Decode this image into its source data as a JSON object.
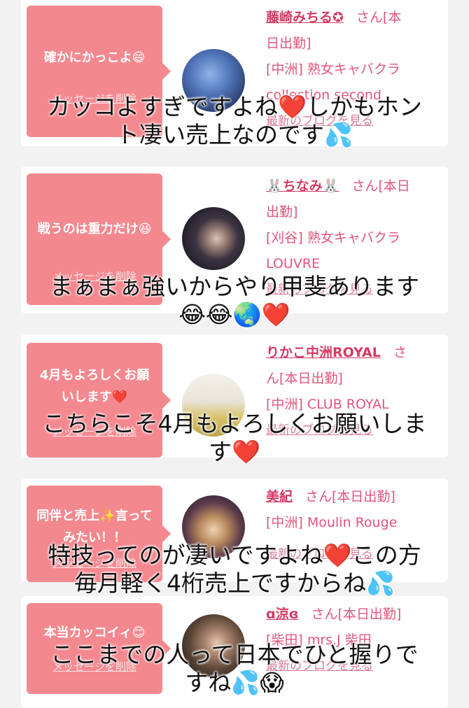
{
  "cards": [
    {
      "message": "確かにかっこよ😄",
      "delete_label": "メッセージを削除",
      "name": "藤崎みちる✪",
      "suffix": "さん[本",
      "line2": "日出勤]",
      "shop": "[中洲] 熟女キャバクラ",
      "shop2": "collection second",
      "blog": "最新のブログを見る",
      "avatar_desc": "blue-rose-avatar"
    },
    {
      "message": "戦うのは重力だけ😆",
      "delete_label": "メッセージを削除",
      "name": "🐰ちなみ🐰",
      "suffix": "さん[本日",
      "line2": "出勤]",
      "shop": "[刈谷] 熟女キャバクラ",
      "shop2": "LOUVRE",
      "blog": "最新のブログを見る",
      "avatar_desc": "woman-avatar"
    },
    {
      "message": "4月もよろしくお願いします❤️",
      "delete_label": "メッセージを削除",
      "name": "りかこ中洲ROYAL",
      "suffix": "さ",
      "line2": "ん[本日出勤]",
      "shop": "[中洲] CLUB ROYAL",
      "shop2": "",
      "blog": "最新のブログを見る",
      "avatar_desc": "flowers-avatar"
    },
    {
      "message": "同伴と売上✨言ってみたい！！",
      "delete_label": "メッセージを削除",
      "name": "美紀",
      "suffix": "さん[本日出勤]",
      "line2": "",
      "shop": "[中洲] Moulin Rouge",
      "shop2": "",
      "blog": "最新のブログを見る",
      "avatar_desc": "woman-avatar"
    },
    {
      "message": "本当カッコイィ😊",
      "delete_label": "メッセージを削除",
      "name": "ɑ涼ɞ",
      "suffix": "さん[本日出勤]",
      "line2": "",
      "shop": "[柴田] mrs.J 柴田",
      "shop2": "",
      "blog": "最新のブログを見る",
      "avatar_desc": "woman-avatar"
    }
  ],
  "captions": [
    {
      "line1": "カッコよすぎですよね❤️しかもホン",
      "line2": "ト凄い売上なのです💦"
    },
    {
      "line1": "まぁまぁ強いからやり甲斐あります",
      "line2": "😂😂🌏❤️"
    },
    {
      "line1": "こちらこそ4月もよろしくお願いしま",
      "line2": "す❤️"
    },
    {
      "line1": "特技ってのが凄いですよね❤️この方",
      "line2": "毎月軽く4桁売上ですからね💦"
    },
    {
      "line1": "ここまでの人って日本でひと握りで",
      "line2": "すね💦😱"
    }
  ],
  "colors": {
    "accent": "#f4888f",
    "link": "#e2547a"
  }
}
